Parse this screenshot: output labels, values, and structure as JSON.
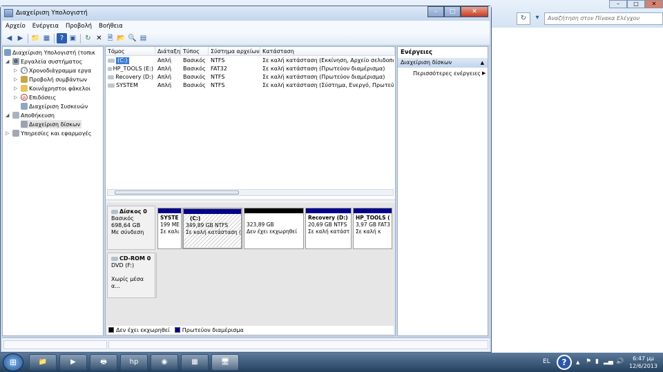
{
  "background_window": {
    "search_placeholder": "Αναζήτηση στον Πίνακα Ελέγχου"
  },
  "window": {
    "title": "Διαχείριση Υπολογιστή",
    "caption_buttons": [
      "–",
      "□",
      "✕"
    ]
  },
  "menu": [
    "Αρχείο",
    "Ενέργεια",
    "Προβολή",
    "Βοήθεια"
  ],
  "toolbar_icons": [
    "back-icon",
    "forward-icon",
    "up-folder-icon",
    "show-hide-tree-icon",
    "help-icon",
    "properties-icon",
    "refresh-icon",
    "delete-icon",
    "properties2-icon",
    "open-icon",
    "search-icon",
    "export-icon"
  ],
  "tree": {
    "root": "Διαχείριση Υπολογιστή (τοπικ",
    "system_tools": "Εργαλεία συστήματος",
    "task_scheduler": "Χρονοδιάγραμμα εργα",
    "event_viewer": "Προβολή συμβάντων",
    "shared_folders": "Κοινόχρηστοι φάκελοι",
    "performance": "Επιδόσεις",
    "device_manager": "Διαχείριση Συσκευών",
    "storage": "Αποθήκευση",
    "disk_management": "Διαχείριση δίσκων",
    "services": "Υπηρεσίες και εφαρμογές"
  },
  "volume_list": {
    "headers": [
      "Τόμος",
      "Διάταξη",
      "Τύπος",
      "Σύστημα αρχείων",
      "Κατάσταση"
    ],
    "rows": [
      {
        "volume": "(C:)",
        "layout": "Απλή",
        "type": "Βασικός",
        "fs": "NTFS",
        "status": "Σε καλή κατάσταση (Εκκίνηση, Αρχείο σελιδοποιησ"
      },
      {
        "volume": "HP_TOOLS (E:)",
        "layout": "Απλή",
        "type": "Βασικός",
        "fs": "FAT32",
        "status": "Σε καλή κατάσταση (Πρωτεύον διαμέρισμα)"
      },
      {
        "volume": "Recovery (D:)",
        "layout": "Απλή",
        "type": "Βασικός",
        "fs": "NTFS",
        "status": "Σε καλή κατάσταση (Πρωτεύον διαμέρισμα)"
      },
      {
        "volume": "SYSTEM",
        "layout": "Απλή",
        "type": "Βασικός",
        "fs": "NTFS",
        "status": "Σε καλή κατάσταση (Σύστημα, Ενεργό, Πρωτεύον δ"
      }
    ]
  },
  "disk0": {
    "name": "Δίσκος 0",
    "type": "Βασικός",
    "size": "698,64 GB",
    "state": "Με σύνδεση",
    "volumes": [
      {
        "title": "SYSTE",
        "line1": "199 ME",
        "line2": "Σε καλι"
      },
      {
        "title": "(C:)",
        "line1": "349,89 GB NTFS",
        "line2": "Σε καλή κατάσταση ("
      },
      {
        "title": "",
        "line1": "323,89 GB",
        "line2": "Δεν έχει εκχωρηθεί"
      },
      {
        "title": "Recovery  (D:)",
        "line1": "20,69 GB NTFS",
        "line2": "Σε καλή κατάστ"
      },
      {
        "title": "HP_TOOLS  (",
        "line1": "3,97 GB FAT3",
        "line2": "Σε καλή κ"
      }
    ]
  },
  "cdrom": {
    "name": "CD-ROM 0",
    "type": "DVD (F:)",
    "state": "Χωρίς μέσα α..."
  },
  "legend": {
    "unallocated": "Δεν έχει εκχωρηθεί",
    "primary": "Πρωτεύον διαμέρισμα"
  },
  "actions": {
    "title": "Ενέργειες",
    "section": "Διαχείριση δίσκων",
    "more": "Περισσότερες ενέργειες"
  },
  "taskbar": {
    "apps": [
      "file-explorer-icon",
      "media-player-icon",
      "printer-icon",
      "hp-icon",
      "chrome-icon",
      "control-panel-icon",
      "computer-management-icon"
    ],
    "language": "EL",
    "time": "6:47 μμ",
    "date": "12/6/2013"
  },
  "colors": {
    "primary_partition": "#00008b",
    "unallocated": "#000000"
  }
}
